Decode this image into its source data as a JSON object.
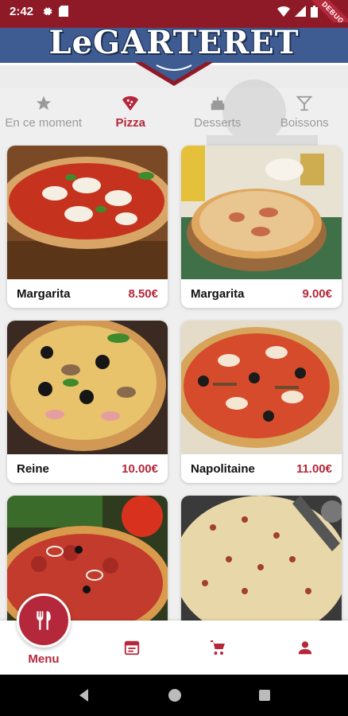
{
  "status_bar": {
    "time": "2:42",
    "debug_label": "DEBUG"
  },
  "header": {
    "logo_text": "LeGARTERET"
  },
  "tabs": [
    {
      "label": "En ce moment",
      "icon": "star-icon",
      "active": false
    },
    {
      "label": "Pizza",
      "icon": "pizza-slice-icon",
      "active": true
    },
    {
      "label": "Desserts",
      "icon": "cake-icon",
      "active": false
    },
    {
      "label": "Boissons",
      "icon": "cocktail-glass-icon",
      "active": false
    }
  ],
  "products": [
    {
      "name": "Margarita",
      "price": "8.50€"
    },
    {
      "name": "Margarita",
      "price": "9.00€"
    },
    {
      "name": "Reine",
      "price": "10.00€"
    },
    {
      "name": "Napolitaine",
      "price": "11.00€"
    },
    {
      "name": "",
      "price": ""
    },
    {
      "name": "",
      "price": ""
    }
  ],
  "bottom_nav": {
    "menu_label": "Menu",
    "items": [
      "fork-knife-icon",
      "calendar-icon",
      "cart-icon",
      "person-icon"
    ]
  },
  "colors": {
    "brand_red": "#b5273a",
    "status_bar": "#8f1a27",
    "header_blue": "#3e5c92"
  }
}
